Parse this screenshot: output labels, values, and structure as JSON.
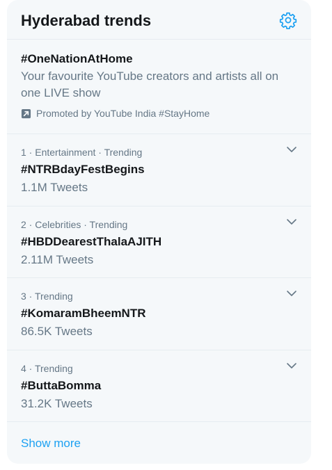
{
  "header": {
    "title": "Hyderabad trends",
    "settings_icon": "gear-icon"
  },
  "promoted": {
    "hashtag": "#OneNationAtHome",
    "description": "Your favourite YouTube creators and artists all on one LIVE show",
    "promoted_by": "Promoted by YouTube India #StayHome",
    "icon": "promoted-arrow-icon"
  },
  "trends": [
    {
      "meta": "1 · Entertainment · Trending",
      "name": "#NTRBdayFestBegins",
      "count": "1.1M Tweets"
    },
    {
      "meta": "2 · Celebrities · Trending",
      "name": "#HBDDearestThalaAJITH",
      "count": "2.11M Tweets"
    },
    {
      "meta": "3 · Trending",
      "name": "#KomaramBheemNTR",
      "count": "86.5K Tweets"
    },
    {
      "meta": "4 · Trending",
      "name": "#ButtaBomma",
      "count": "31.2K Tweets"
    }
  ],
  "footer": {
    "show_more": "Show more"
  },
  "colors": {
    "accent": "#1da1f2",
    "panel_bg": "#f5f8fa",
    "primary_text": "#14171a",
    "secondary_text": "#657786",
    "divider": "#e6ecf0"
  }
}
